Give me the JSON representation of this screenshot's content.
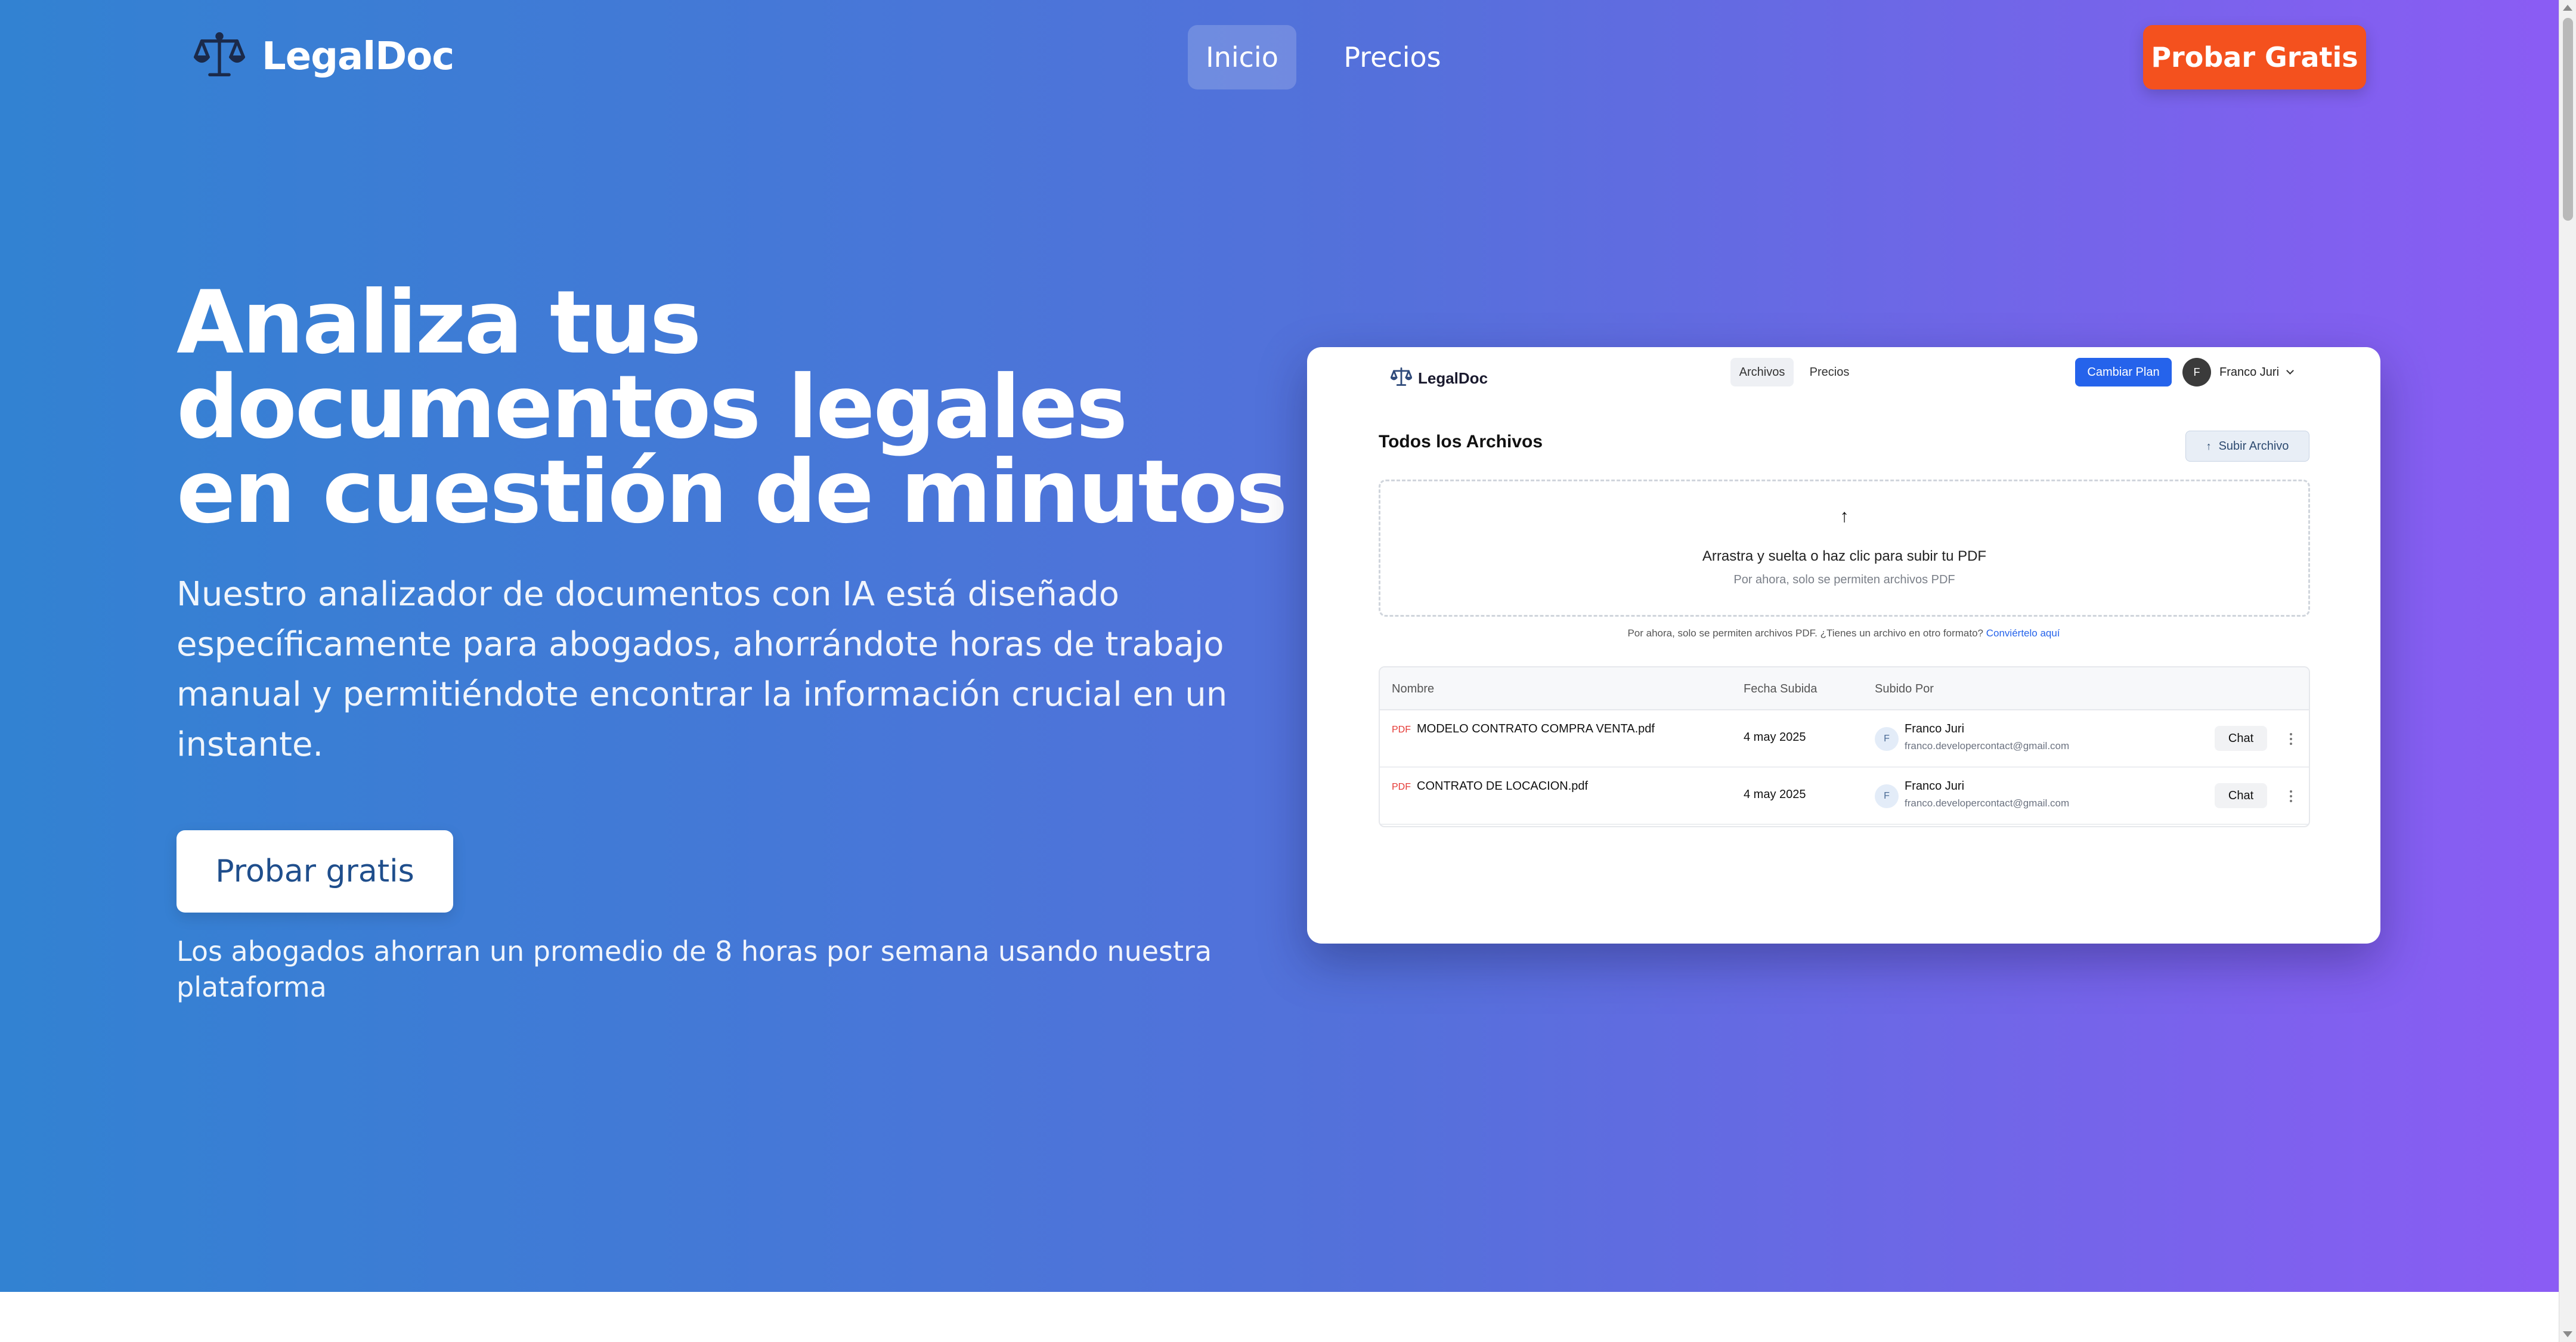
{
  "nav": {
    "brand": "LegalDoc",
    "links": [
      {
        "label": "Inicio",
        "active": true
      },
      {
        "label": "Precios",
        "active": false
      }
    ],
    "cta": "Probar Gratis"
  },
  "hero": {
    "headline_lines": [
      "Analiza tus",
      "documentos legales",
      "en cuestión de minutos"
    ],
    "subheadline": "Nuestro analizador de documentos con IA está diseñado específicamente para abogados, ahorrándote horas de trabajo manual y permitiéndote encontrar la información crucial en un instante.",
    "cta": "Probar gratis",
    "note": "Los abogados ahorran un promedio de 8 horas por semana usando nuestra plataforma"
  },
  "preview": {
    "brand": "LegalDoc",
    "tabs": [
      "Archivos",
      "Precios"
    ],
    "plan_button": "Cambiar Plan",
    "user": {
      "initial": "F",
      "name": "Franco Juri"
    },
    "title": "Todos los Archivos",
    "upload_button": "Subir Archivo",
    "dropzone": {
      "text": "Arrastra y suelta o haz clic para subir tu PDF",
      "subtext": "Por ahora, solo se permiten archivos PDF"
    },
    "notice": {
      "text": "Por ahora, solo se permiten archivos PDF. ¿Tienes un archivo en otro formato?",
      "link": "Conviértelo aquí"
    },
    "table": {
      "columns": [
        "Nombre",
        "Fecha Subida",
        "Subido Por"
      ],
      "rows": [
        {
          "type": "PDF",
          "name": "MODELO CONTRATO COMPRA VENTA.pdf",
          "date": "4 may 2025",
          "initial": "F",
          "user": "Franco Juri",
          "email": "franco.developercontact@gmail.com",
          "action": "Chat"
        },
        {
          "type": "PDF",
          "name": "CONTRATO DE LOCACION.pdf",
          "date": "4 may 2025",
          "initial": "F",
          "user": "Franco Juri",
          "email": "franco.developercontact@gmail.com",
          "action": "Chat"
        }
      ]
    }
  },
  "colors": {
    "gradient_start": "#3282d2",
    "gradient_end": "#8b5cf4",
    "cta_orange": "#f4511e",
    "preview_primary": "#2563eb"
  },
  "icons": {
    "logo": "scales-of-justice-icon",
    "upload": "arrow-up-icon",
    "more": "more-vertical-icon",
    "chevron": "chevron-down-icon"
  }
}
